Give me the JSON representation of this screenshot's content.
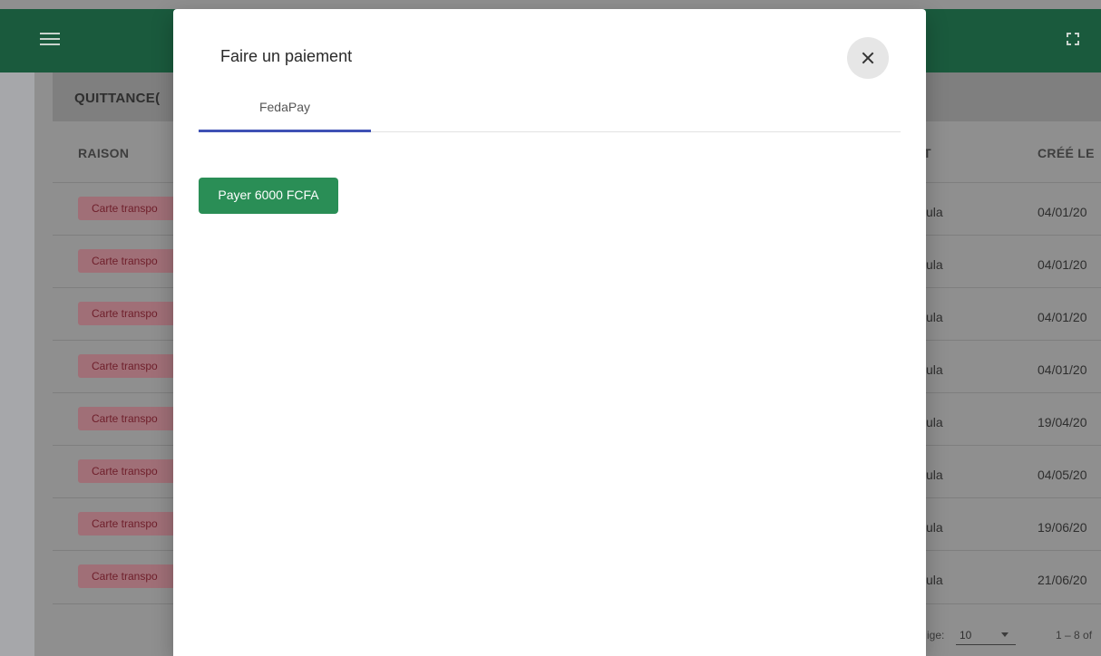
{
  "app": {
    "menu_icon": "hamburger-menu-icon",
    "fullscreen_icon": "fullscreen-icon",
    "card_title": "QUITTANCE(",
    "columns": {
      "raison": "RAISON",
      "partial": "T",
      "created": "CRÉÉ LE"
    },
    "rows": [
      {
        "raison": "Carte transpo",
        "cell": "ula",
        "date": "04/01/20"
      },
      {
        "raison": "Carte transpo",
        "cell": "ula",
        "date": "04/01/20"
      },
      {
        "raison": "Carte transpo",
        "cell": "ula",
        "date": "04/01/20"
      },
      {
        "raison": "Carte transpo",
        "cell": "ula",
        "date": "04/01/20"
      },
      {
        "raison": "Carte transpo",
        "cell": "ula",
        "date": "19/04/20"
      },
      {
        "raison": "Carte transpo",
        "cell": "ula",
        "date": "04/05/20"
      },
      {
        "raison": "Carte transpo",
        "cell": "ula",
        "date": "19/06/20"
      },
      {
        "raison": "Carte transpo",
        "cell": "ula",
        "date": "21/06/20"
      }
    ],
    "pager": {
      "per_page_label": "ige:",
      "per_page_value": "10",
      "range": "1 – 8 of"
    }
  },
  "modal": {
    "title": "Faire un paiement",
    "close_icon": "close-icon",
    "tabs": [
      {
        "label": "FedaPay",
        "active": true
      }
    ],
    "pay_button": "Payer 6000 FCFA"
  },
  "colors": {
    "topbar": "#1a5a3d",
    "tab_indicator": "#3f51b5",
    "pay_button": "#2a8e56"
  }
}
